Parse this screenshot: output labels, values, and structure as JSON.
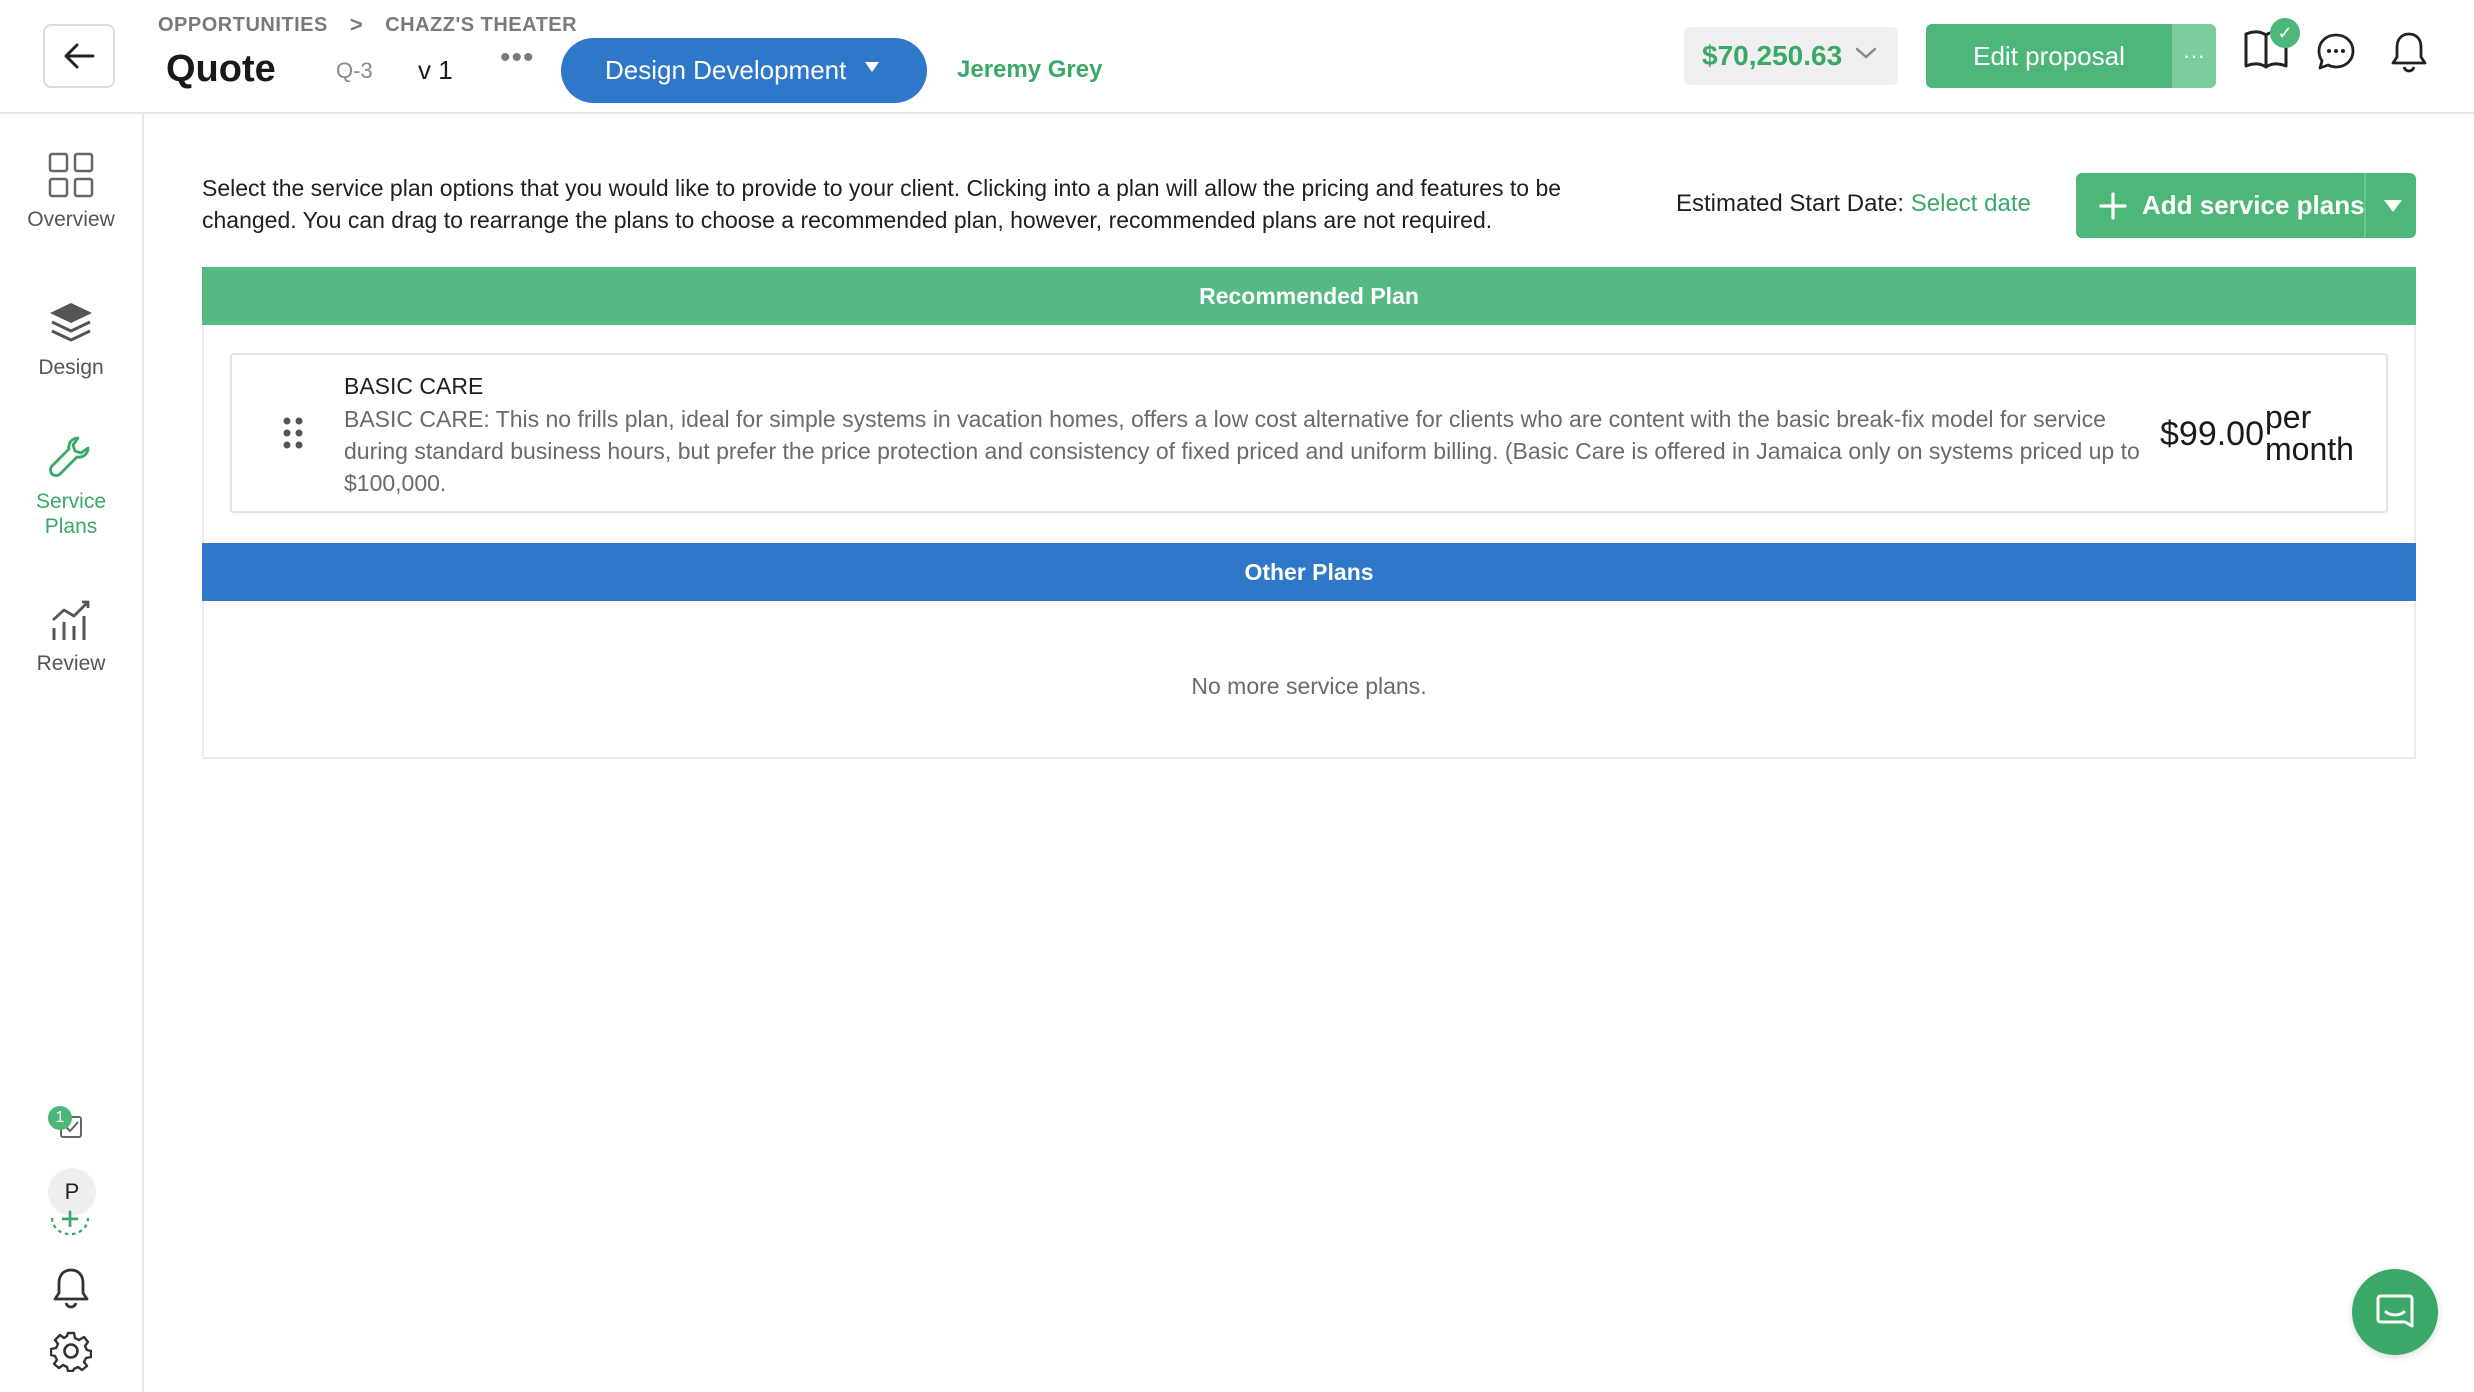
{
  "header": {
    "breadcrumbs": [
      "OPPORTUNITIES",
      "CHAZZ'S THEATER"
    ],
    "breadcrumb_separator": ">",
    "title": "Quote",
    "quote_number": "Q-3",
    "version": "v 1",
    "more_label": "•••",
    "stage": "Design Development",
    "owner": "Jeremy Grey",
    "total_price": "$70,250.63",
    "edit_proposal": "Edit proposal",
    "edit_more": "···",
    "book_badge": "✓"
  },
  "sidebar": {
    "items": [
      {
        "label": "Overview",
        "icon": "grid-icon"
      },
      {
        "label": "Design",
        "icon": "layers-icon"
      },
      {
        "label": "Service\nPlans",
        "icon": "wrench-icon"
      },
      {
        "label": "Review",
        "icon": "chart-icon"
      }
    ],
    "active": "Service Plans",
    "task_count": "1",
    "avatar_initial": "P"
  },
  "main": {
    "intro": "Select the service plan options that you would like to provide to your client. Clicking into a plan will allow the pricing and features to be changed. You can drag to rearrange the plans to choose a recommended plan, however, recommended plans are not required.",
    "start_date_label": "Estimated Start Date:",
    "start_date_link": "Select date",
    "add_plans_label": "Add service plans",
    "recommended_title": "Recommended Plan",
    "other_title": "Other Plans",
    "empty_message": "No more service plans.",
    "plans": [
      {
        "name": "BASIC CARE",
        "description": "BASIC CARE: This no frills plan, ideal for simple systems in vacation homes, offers a low cost alternative for clients who are content with the basic break-fix model for service during standard business hours, but prefer the price protection and consistency of fixed priced and uniform billing. (Basic Care is offered in Jamaica only on systems priced up to $100,000.",
        "price": "$99.00",
        "period": "per month"
      }
    ]
  },
  "colors": {
    "green": "#4db77a",
    "green_text": "#3aa867",
    "blue": "#2f78c9"
  }
}
